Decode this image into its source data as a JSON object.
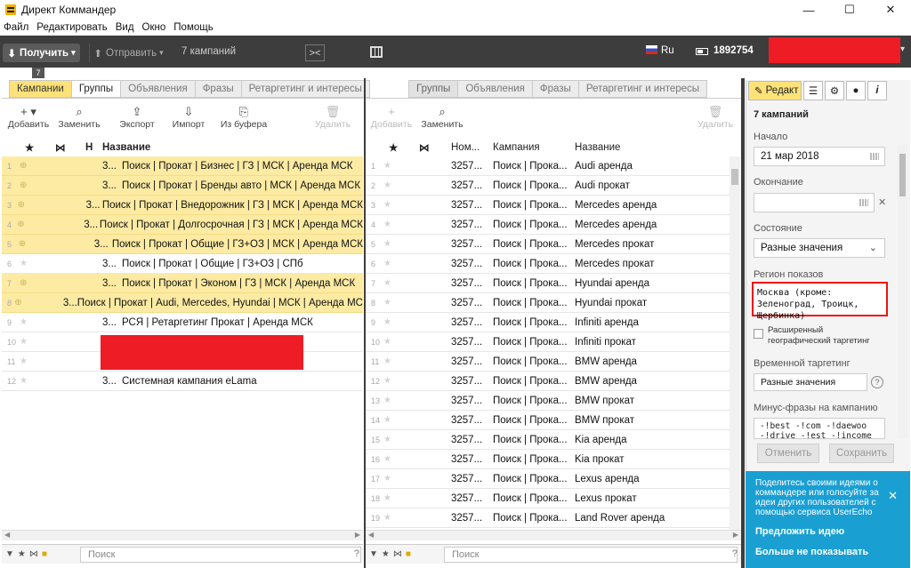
{
  "window": {
    "title": "Директ Коммандер",
    "controls": [
      "—",
      "☐",
      "✕"
    ]
  },
  "menu": [
    "Файл",
    "Редактировать",
    "Вид",
    "Окно",
    "Помощь"
  ],
  "toolbar": {
    "get_label": "Получить",
    "send_label": "Отправить",
    "campaign_count": "7 кампаний",
    "collapse_label": "><",
    "language": "Ru",
    "balance": "1892754",
    "badge": "7"
  },
  "left_panel": {
    "tabs": [
      "Кампании",
      "Группы",
      "Объявления",
      "Фразы",
      "Ретаргетинг и интересы"
    ],
    "actions": [
      "Добавить",
      "Заменить",
      "Экспорт",
      "Импорт",
      "Из буфера",
      "Удалить"
    ],
    "columns": [
      "★",
      "⋈",
      "Н",
      "Название"
    ],
    "rows": [
      {
        "n": "1",
        "id": "3...",
        "name": "Поиск | Прокат | Бизнес | ГЗ | МСК | Аренда МСК",
        "hl": true
      },
      {
        "n": "2",
        "id": "3...",
        "name": "Поиск | Прокат | Бренды авто | МСК | Аренда МСК",
        "hl": true
      },
      {
        "n": "3",
        "id": "3...",
        "name": "Поиск | Прокат | Внедорожник | ГЗ | МСК | Аренда МСК",
        "hl": true
      },
      {
        "n": "4",
        "id": "3...",
        "name": "Поиск | Прокат | Долгосрочная | ГЗ | МСК | Аренда МСК",
        "hl": true
      },
      {
        "n": "5",
        "id": "3...",
        "name": "Поиск | Прокат | Общие | ГЗ+ОЗ | МСК | Аренда МСК",
        "hl": true
      },
      {
        "n": "6",
        "id": "3...",
        "name": "Поиск | Прокат | Общие | ГЗ+ОЗ | СПб",
        "hl": false
      },
      {
        "n": "7",
        "id": "3...",
        "name": "Поиск | Прокат | Эконом | ГЗ | МСК | Аренда МСК",
        "hl": true
      },
      {
        "n": "8",
        "id": "3...",
        "name": "Поиск | Прокат | Audi, Mercedes, Hyundai | МСК | Аренда МС",
        "hl": true
      },
      {
        "n": "9",
        "id": "3...",
        "name": "РСЯ | Ретаргетинг Прокат | Аренда МСК",
        "hl": false
      },
      {
        "n": "10",
        "id": "3...",
        "name": "",
        "hl": false
      },
      {
        "n": "11",
        "id": "5...",
        "name": "",
        "hl": false
      },
      {
        "n": "12",
        "id": "3...",
        "name": "Системная кампания eLama",
        "hl": false
      }
    ],
    "search_placeholder": "Поиск",
    "help": "?"
  },
  "middle_panel": {
    "tabs": [
      "Группы",
      "Объявления",
      "Фразы",
      "Ретаргетинг и интересы"
    ],
    "actions": [
      "Добавить",
      "Заменить",
      "Удалить"
    ],
    "columns": [
      "★",
      "⋈",
      "Ном...",
      "Кампания",
      "Название"
    ],
    "rows": [
      {
        "n": "1",
        "id": "3257...",
        "camp": "Поиск | Прока...",
        "name": "Audi аренда"
      },
      {
        "n": "2",
        "id": "3257...",
        "camp": "Поиск | Прока...",
        "name": "Audi прокат"
      },
      {
        "n": "3",
        "id": "3257...",
        "camp": "Поиск | Прока...",
        "name": "Mercedes аренда"
      },
      {
        "n": "4",
        "id": "3257...",
        "camp": "Поиск | Прока...",
        "name": "Mercedes аренда"
      },
      {
        "n": "5",
        "id": "3257...",
        "camp": "Поиск | Прока...",
        "name": "Mercedes прокат"
      },
      {
        "n": "6",
        "id": "3257...",
        "camp": "Поиск | Прока...",
        "name": "Mercedes прокат"
      },
      {
        "n": "7",
        "id": "3257...",
        "camp": "Поиск | Прока...",
        "name": "Hyundai аренда"
      },
      {
        "n": "8",
        "id": "3257...",
        "camp": "Поиск | Прока...",
        "name": "Hyundai прокат"
      },
      {
        "n": "9",
        "id": "3257...",
        "camp": "Поиск | Прока...",
        "name": "Infiniti аренда"
      },
      {
        "n": "10",
        "id": "3257...",
        "camp": "Поиск | Прока...",
        "name": "Infiniti прокат"
      },
      {
        "n": "11",
        "id": "3257...",
        "camp": "Поиск | Прока...",
        "name": "BMW аренда"
      },
      {
        "n": "12",
        "id": "3257...",
        "camp": "Поиск | Прока...",
        "name": "BMW аренда"
      },
      {
        "n": "13",
        "id": "3257...",
        "camp": "Поиск | Прока...",
        "name": "BMW прокат"
      },
      {
        "n": "14",
        "id": "3257...",
        "camp": "Поиск | Прока...",
        "name": "BMW прокат"
      },
      {
        "n": "15",
        "id": "3257...",
        "camp": "Поиск | Прока...",
        "name": "Kia аренда"
      },
      {
        "n": "16",
        "id": "3257...",
        "camp": "Поиск | Прока...",
        "name": "Kia прокат"
      },
      {
        "n": "17",
        "id": "3257...",
        "camp": "Поиск | Прока...",
        "name": "Lexus аренда"
      },
      {
        "n": "18",
        "id": "3257...",
        "camp": "Поиск | Прока...",
        "name": "Lexus прокат"
      },
      {
        "n": "19",
        "id": "3257...",
        "camp": "Поиск | Прока...",
        "name": "Land Rover аренда"
      }
    ],
    "search_placeholder": "Поиск",
    "help": "?"
  },
  "editor": {
    "tab_label": "Редакт",
    "heading": "7 кампаний",
    "start_label": "Начало",
    "start_value": "21 мар 2018",
    "end_label": "Окончание",
    "end_value": "",
    "clear": "✕",
    "state_label": "Состояние",
    "state_value": "Разные значения",
    "region_label": "Регион показов",
    "region_value": "Москва (кроме: Зеленоград, Троицк, Щербинка)",
    "geo_label": "Расширенный географический таргетинг",
    "time_label": "Временной таргетинг",
    "time_value": "Разные значения",
    "help": "?",
    "minus_label": "Минус-фразы на кампанию",
    "minus_value": "-!best -!com -!daewoo -!drive -!est -!income",
    "cancel": "Отменить",
    "save": "Сохранить"
  },
  "feedback": {
    "message": "Поделитесь своими идеями о коммандере или голосуйте за идеи других пользователей с помощью сервиса UserEcho",
    "close": "✕",
    "suggest": "Предложить идею",
    "hide": "Больше не показывать"
  }
}
